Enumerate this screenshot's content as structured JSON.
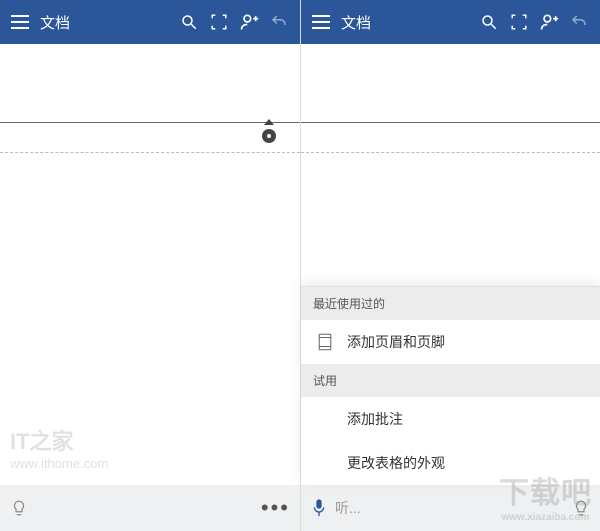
{
  "header": {
    "title": "文档"
  },
  "watermarks": {
    "left_brand": "IT之家",
    "left_url": "www.ithome.com",
    "right_brand": "下载吧",
    "right_url": "www.xiazaiba.com"
  },
  "panel": {
    "recent_label": "最近使用过的",
    "recent_items": [
      "添加页眉和页脚"
    ],
    "try_label": "试用",
    "try_items": [
      "添加批注",
      "更改表格的外观"
    ]
  },
  "bottombar": {
    "listen_placeholder": "听...",
    "more": "•••"
  }
}
